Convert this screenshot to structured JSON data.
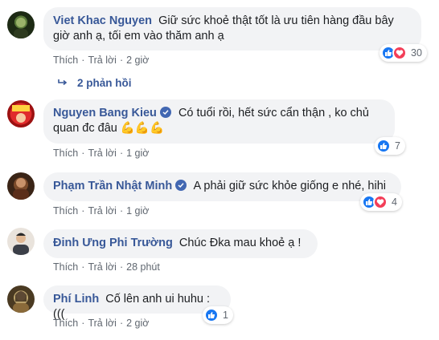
{
  "comments": [
    {
      "name": "Viet Khac Nguyen",
      "text": "Giữ sức khoẻ thật tốt là ưu tiên hàng đầu bây giờ anh ạ, tối em vào thăm anh ạ",
      "verified": false,
      "like_label": "Thích",
      "reply_label": "Trả lời",
      "time": "2 giờ",
      "reactions": [
        "like-icon",
        "love-icon"
      ],
      "reaction_count": "30"
    },
    {
      "name": "Nguyen Bang Kieu",
      "text": "Có tuổi rồi, hết sức cẩn thận , ko chủ quan đc đâu 💪💪💪",
      "verified": true,
      "like_label": "Thích",
      "reply_label": "Trả lời",
      "time": "1 giờ",
      "reactions": [
        "like-icon"
      ],
      "reaction_count": "7"
    },
    {
      "name": "Phạm Trần Nhật Minh",
      "text": "A phải giữ sức khỏe giống e nhé, hihi",
      "verified": true,
      "like_label": "Thích",
      "reply_label": "Trả lời",
      "time": "1 giờ",
      "reactions": [
        "like-icon",
        "love-icon"
      ],
      "reaction_count": "4"
    },
    {
      "name": "Đinh Ưng Phi Trường",
      "text": "Chúc Đka mau khoẻ ạ !",
      "verified": false,
      "like_label": "Thích",
      "reply_label": "Trả lời",
      "time": "28 phút"
    },
    {
      "name": "Phí Linh",
      "text": "Cố lên anh ui huhu :(((",
      "verified": false,
      "like_label": "Thích",
      "reply_label": "Trả lời",
      "time": "2 giờ",
      "reactions": [
        "like-icon"
      ],
      "reaction_count": "1"
    }
  ],
  "replies_link": "2 phản hồi",
  "colors": {
    "name": "#385898",
    "bubble": "#f2f3f5",
    "meta": "#606770",
    "like": "#1877f2",
    "love": "#f33e58"
  }
}
